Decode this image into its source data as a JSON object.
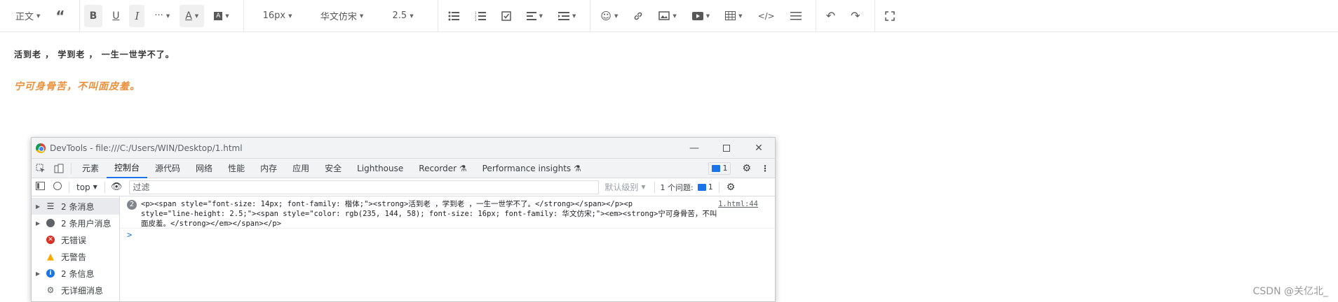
{
  "toolbar": {
    "heading": "正文",
    "font_size": "16px",
    "font_family": "华文仿宋",
    "line_height": "2.5",
    "more": "···"
  },
  "content": {
    "line1": "活到老 ， 学到老 ， 一生一世学不了。",
    "line2": "宁可身骨苦，不叫面皮羞。",
    "line2_color": "#eb903a"
  },
  "watermark": "CSDN @关亿北_",
  "devtools": {
    "title": "DevTools - file:///C:/Users/WIN/Desktop/1.html",
    "tabs": [
      "元素",
      "控制台",
      "源代码",
      "网络",
      "性能",
      "内存",
      "应用",
      "安全",
      "Lighthouse",
      "Recorder ⚗",
      "Performance insights ⚗"
    ],
    "issues_badge": "1",
    "context": "top",
    "filter_placeholder": "过滤",
    "level": "默认级别",
    "issues_label": "1 个问题:",
    "issues_count": "1",
    "sidebar": [
      {
        "label": "2 条消息",
        "icon": "list-icon"
      },
      {
        "label": "2 条用户消息",
        "icon": "user-icon"
      },
      {
        "label": "无错误",
        "icon": "error-icon"
      },
      {
        "label": "无警告",
        "icon": "warning-icon"
      },
      {
        "label": "2 条信息",
        "icon": "info-icon"
      },
      {
        "label": "无详细消息",
        "icon": "gear-icon"
      }
    ],
    "log": {
      "count": "2",
      "line1": "<p><span style=\"font-size: 14px; font-family: 楷体;\"><strong>活到老 ，学到老 ，一生一世学不了。</strong></span></p><p",
      "line2": "style=\"line-height: 2.5;\"><span style=\"color: rgb(235, 144, 58); font-size: 16px; font-family: 华文仿宋;\"><em><strong>宁可身骨苦，不叫",
      "line3": "面皮羞。</strong></em></span></p>",
      "source": "1.html:44"
    },
    "prompt": ">"
  }
}
